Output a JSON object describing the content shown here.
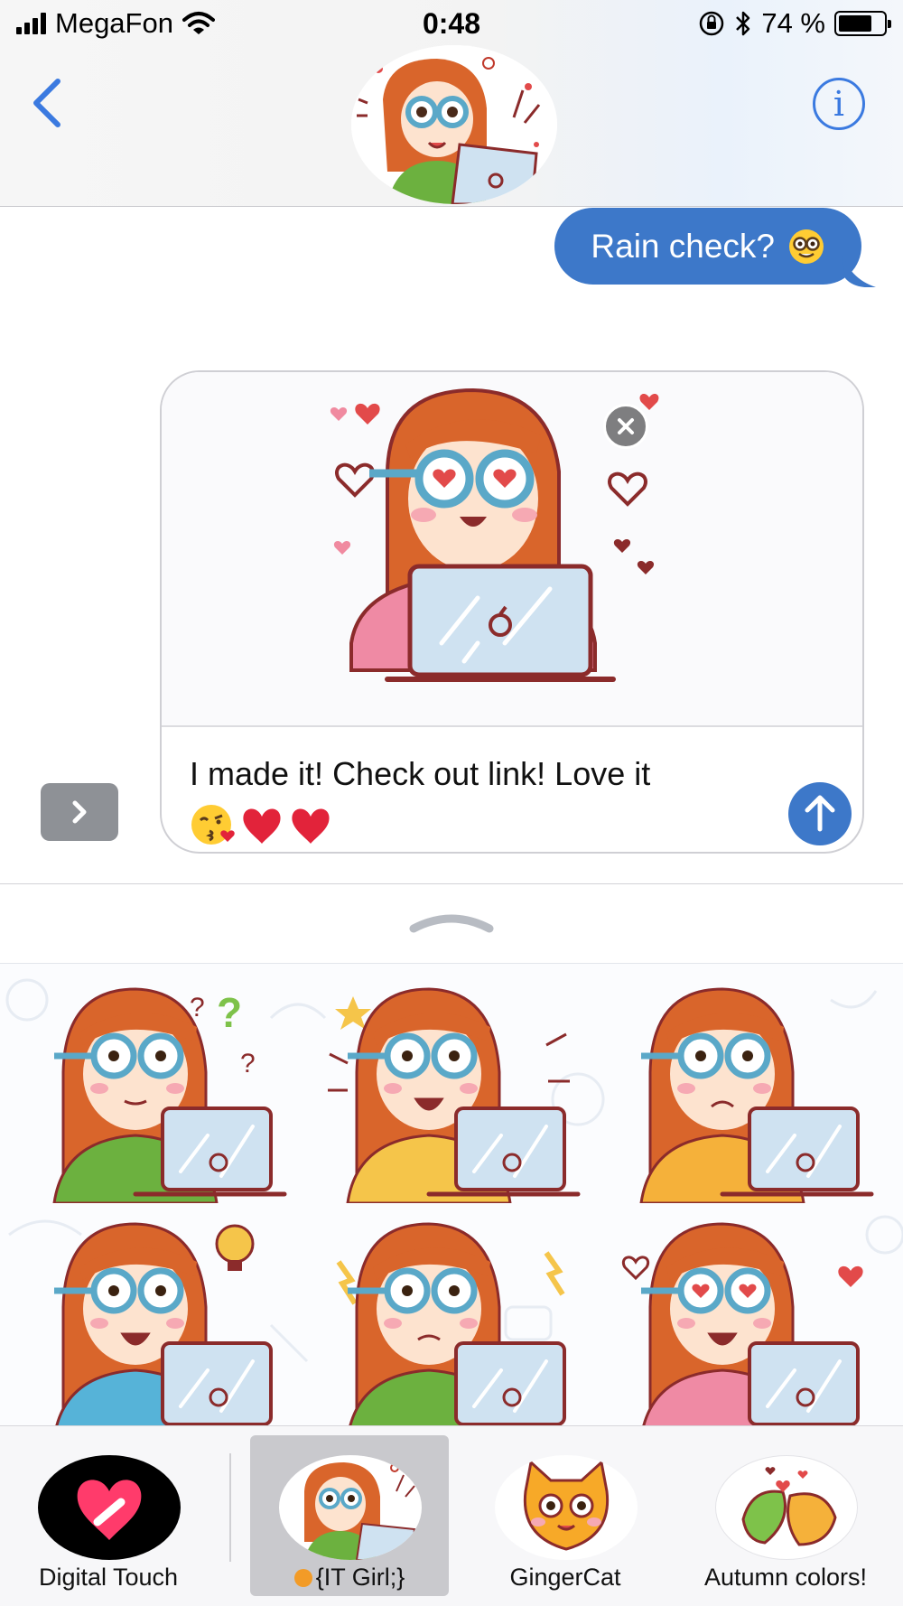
{
  "status_bar": {
    "carrier": "MegaFon",
    "time": "0:48",
    "battery": "74 %",
    "battery_level": 0.74
  },
  "header": {
    "contact_avatar": "it-girl-avatar",
    "info_label": "i"
  },
  "messages": [
    {
      "direction": "outgoing",
      "text": "Rain check?",
      "emoji": "nerd-face"
    }
  ],
  "compose": {
    "attached_sticker": "it-girl-love-sticker",
    "text": "I made it! Check out link! Love it",
    "emojis": [
      "kissing-face",
      "red-heart",
      "red-heart"
    ]
  },
  "sticker_pack": {
    "stickers": [
      "it-girl-thinking",
      "it-girl-excited",
      "it-girl-worried",
      "it-girl-idea",
      "it-girl-angry",
      "it-girl-in-love"
    ]
  },
  "app_drawer": {
    "apps": [
      {
        "label": "Digital Touch",
        "icon": "digital-touch-icon"
      },
      {
        "label": "{IT Girl;}",
        "icon": "it-girl-app-icon",
        "selected": true,
        "badge_color": "#f29b27"
      },
      {
        "label": "GingerCat",
        "icon": "ginger-cat-icon"
      },
      {
        "label": "Autumn colors!",
        "icon": "autumn-leaves-icon"
      }
    ]
  },
  "colors": {
    "accent": "#3d78c9",
    "hair": "#d9652b",
    "glasses": "#5aa8c8"
  }
}
